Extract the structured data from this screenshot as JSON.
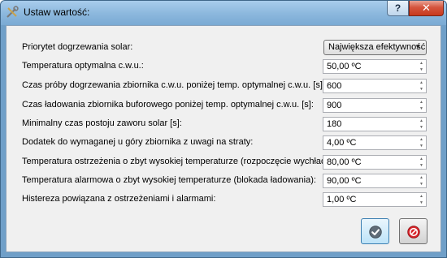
{
  "window": {
    "title": "Ustaw wartość:",
    "help_label": "?",
    "close_label": "✕"
  },
  "priority": {
    "label": "Priorytet dogrzewania solar:",
    "selected": "Największa efektywność"
  },
  "settings": [
    {
      "label": "Temperatura optymalna c.w.u.:",
      "value": "50,00 ºC"
    },
    {
      "label": "Czas próby dogrzewania zbiornika c.w.u. poniżej temp. optymalnej c.w.u. [s]:",
      "value": "600"
    },
    {
      "label": "Czas ładowania zbiornika buforowego poniżej temp. optymalnej c.w.u. [s]:",
      "value": "900"
    },
    {
      "label": "Minimalny czas postoju zaworu solar [s]:",
      "value": "180"
    },
    {
      "label": "Dodatek do wymaganej u góry zbiornika z uwagi na straty:",
      "value": "4,00 ºC"
    },
    {
      "label": "Temperatura ostrzeżenia o zbyt wysokiej temperaturze (rozpoczęcie wychładzania):",
      "value": "80,00 ºC"
    },
    {
      "label": "Temperatura alarmowa o zbyt wysokiej temperaturze (blokada ładowania):",
      "value": "90,00 ºC"
    },
    {
      "label": "Histereza powiązana z ostrzeżeniami i alarmami:",
      "value": "1,00 ºC"
    }
  ],
  "icons": {
    "app": "tools-icon",
    "ok": "checkmark-icon",
    "cancel": "no-entry-icon"
  },
  "colors": {
    "title_bar": "#8db9de",
    "close_button": "#c8391d",
    "dialog_bg": "#f0f0f0",
    "cancel_icon": "#d8242a"
  }
}
